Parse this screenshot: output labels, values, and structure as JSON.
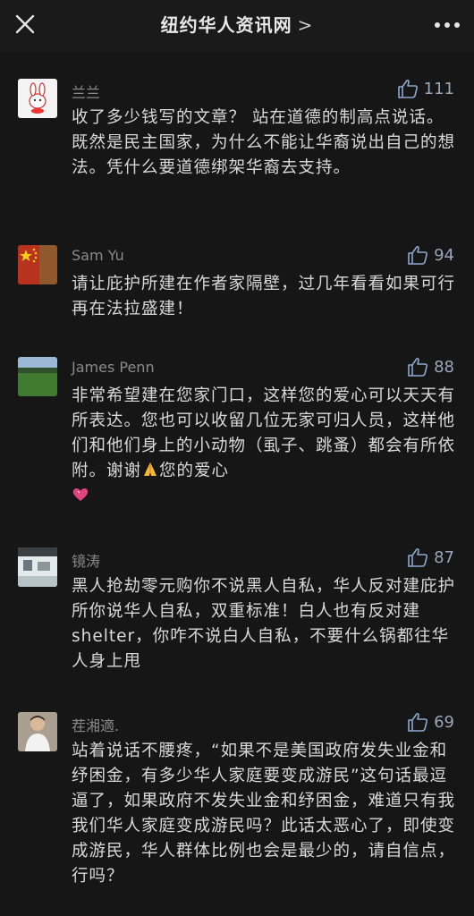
{
  "header": {
    "title": "纽约华人资讯网",
    "chevron": ">"
  },
  "comments": [
    {
      "name": "兰兰",
      "likes": "111",
      "text": "收了多少钱写的文章？ 站在道德的制高点说话。既然是民主国家，为什么不能让华裔说出自己的想法。凭什么要道德绑架华裔去支持。",
      "avatar": "bunny-avatar"
    },
    {
      "name": "Sam Yu",
      "likes": "94",
      "text": "请让庇护所建在作者家隔壁，过几年看看如果可行再在法拉盛建！",
      "avatar": "china-flag-avatar"
    },
    {
      "name": "James Penn",
      "likes": "88",
      "text_part1": "非常希望建在您家门口，这样您的爱心可以天天有所表达。您也可以收留几位无家可归人员，这样他们和他们身上的小动物（虱子、跳蚤）都会有所依附。谢谢",
      "text_part2": "您的爱心",
      "avatar": "grass-field-avatar",
      "emoji1": "pray-emoji",
      "emoji2": "pink-heart-emoji"
    },
    {
      "name": "镜涛",
      "likes": "87",
      "text": "黑人抢劫零元购你不说黑人自私，华人反对建庇护所你说华人自私，双重标准！白人也有反对建shelter，你咋不说白人自私，不要什么锅都往华人身上甩",
      "avatar": "building-photo-avatar"
    },
    {
      "name": "茬湘適.",
      "likes": "69",
      "text": "站着说话不腰疼，“如果不是美国政府发失业金和纾困金，有多少华人家庭要变成游民”这句话最逗逼了，如果政府不发失业金和纾困金，难道只有我我们华人家庭变成游民吗？此话太恶心了，即使变成游民，华人群体比例也会是最少的，请自信点，行吗？",
      "avatar": "person-photo-avatar"
    }
  ]
}
